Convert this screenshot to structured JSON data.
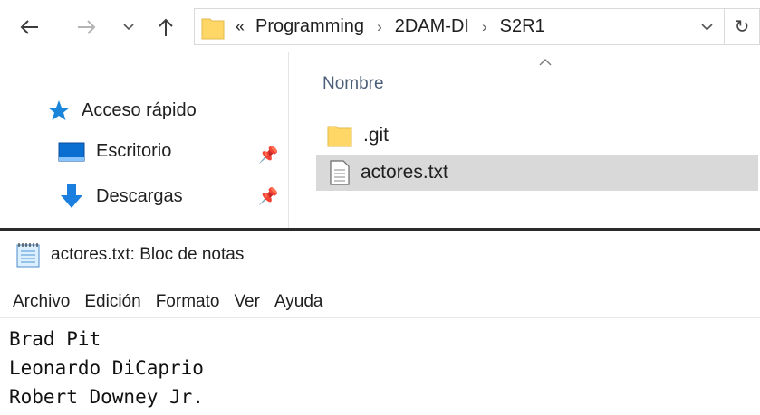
{
  "explorer": {
    "address": {
      "overflow": "«",
      "crumbs": [
        "Programming",
        "2DAM-DI",
        "S2R1"
      ]
    },
    "nav": {
      "quick_access": "Acceso rápido",
      "desktop": "Escritorio",
      "downloads": "Descargas"
    },
    "content": {
      "column_name": "Nombre",
      "files": [
        {
          "name": ".git",
          "type": "folder"
        },
        {
          "name": "actores.txt",
          "type": "text"
        }
      ]
    },
    "colors": {
      "folder": "#ffd767",
      "star": "#1a86d9",
      "desktop": "#0a6fd1",
      "download": "#1b7fe0",
      "selected": "#d9d9d9"
    }
  },
  "notepad": {
    "title": "actores.txt: Bloc de notas",
    "menu": [
      "Archivo",
      "Edición",
      "Formato",
      "Ver",
      "Ayuda"
    ],
    "lines": [
      "Brad Pit",
      "Leonardo DiCaprio",
      "Robert Downey Jr."
    ]
  }
}
